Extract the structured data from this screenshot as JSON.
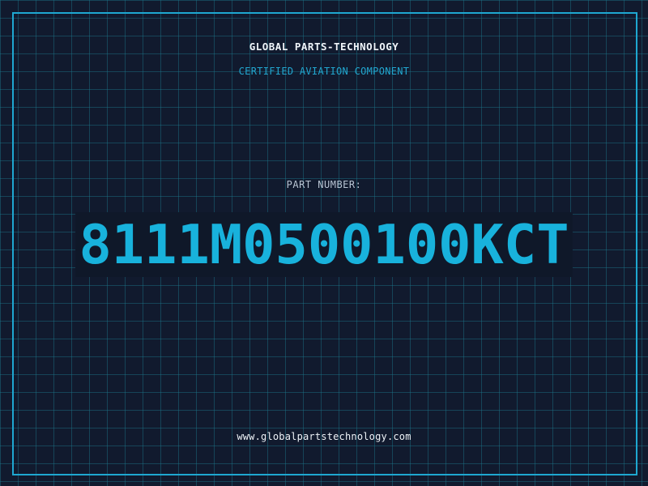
{
  "header": {
    "brand": "GLOBAL PARTS-TECHNOLOGY",
    "tagline": "CERTIFIED AVIATION COMPONENT"
  },
  "part": {
    "label": "PART NUMBER:",
    "number": "8111M0500100KCT"
  },
  "footer": {
    "website": "www.globalpartstechnology.com"
  },
  "colors": {
    "background": "#111a2e",
    "grid": "#1c788c",
    "accent": "#1ea7d0",
    "part_number": "#18b2dc",
    "text_light": "#eef3f8",
    "text_muted": "#b8c4d3"
  }
}
